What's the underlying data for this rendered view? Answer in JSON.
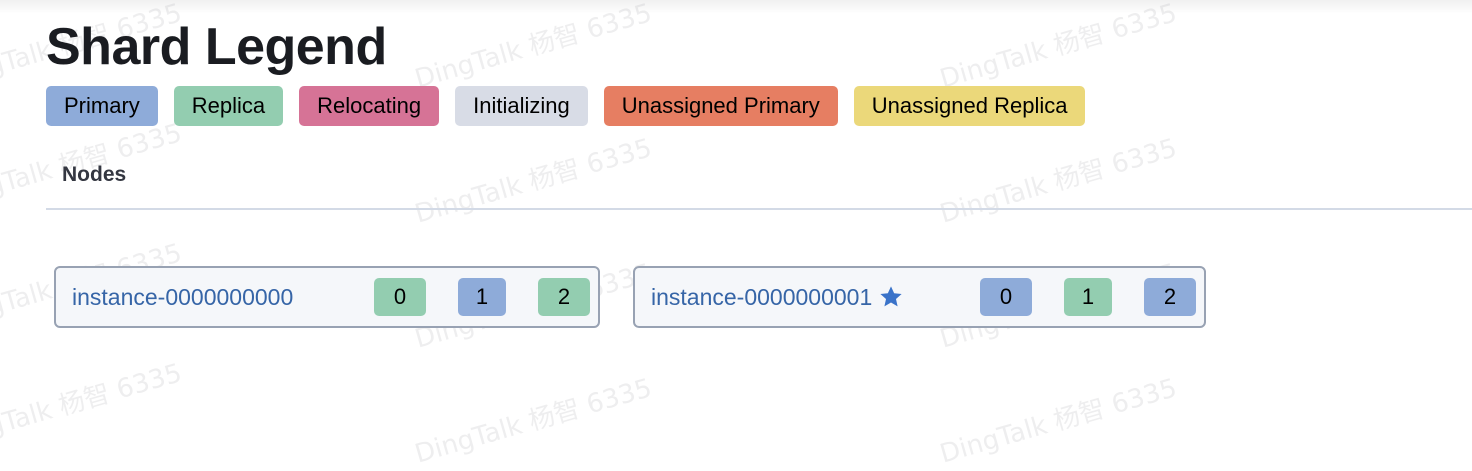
{
  "page": {
    "title": "Shard Legend",
    "section_title": "Nodes"
  },
  "legend": [
    {
      "label": "Primary",
      "color": "#8eabd9"
    },
    {
      "label": "Replica",
      "color": "#93cdb0"
    },
    {
      "label": "Relocating",
      "color": "#d67396"
    },
    {
      "label": "Initializing",
      "color": "#d8dce6"
    },
    {
      "label": "Unassigned Primary",
      "color": "#e67e62"
    },
    {
      "label": "Unassigned Replica",
      "color": "#ebd87a"
    }
  ],
  "nodes": [
    {
      "name": "instance-0000000000",
      "master": false,
      "shards": [
        {
          "label": "0",
          "state": "replica",
          "color": "#93cdb0"
        },
        {
          "label": "1",
          "state": "primary",
          "color": "#8eabd9"
        },
        {
          "label": "2",
          "state": "replica",
          "color": "#93cdb0"
        }
      ]
    },
    {
      "name": "instance-0000000001",
      "master": true,
      "master_icon": "star-icon",
      "shards": [
        {
          "label": "0",
          "state": "primary",
          "color": "#8eabd9"
        },
        {
          "label": "1",
          "state": "replica",
          "color": "#93cdb0"
        },
        {
          "label": "2",
          "state": "primary",
          "color": "#8eabd9"
        }
      ]
    }
  ],
  "watermark": {
    "text": "DingTalk 杨智 6335"
  }
}
